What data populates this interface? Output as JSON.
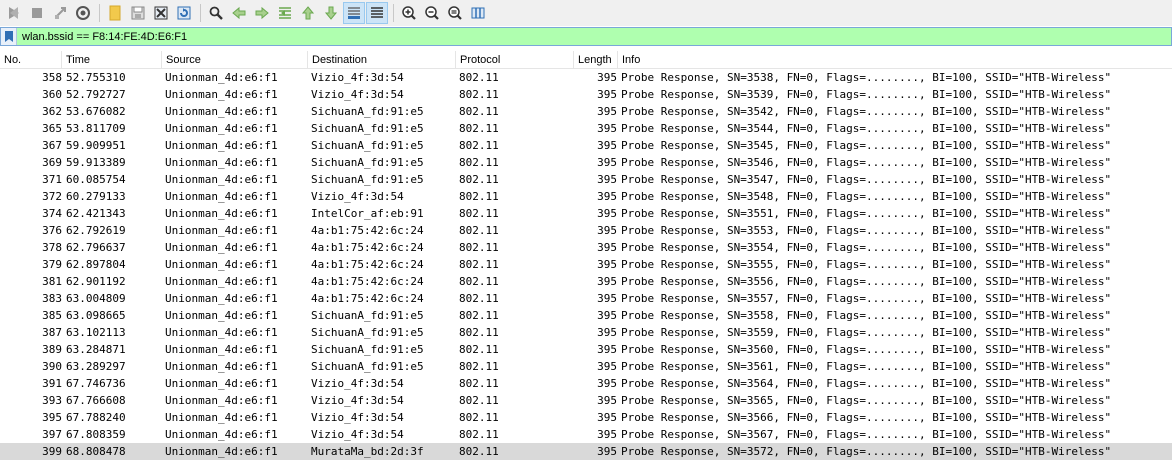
{
  "toolbar": {
    "buttons": [
      {
        "name": "start-capture-icon",
        "color": "#9a9a9a"
      },
      {
        "name": "stop-capture-icon",
        "color": "#9a9a9a"
      },
      {
        "name": "restart-capture-icon",
        "color": "#9a9a9a"
      },
      {
        "name": "capture-options-gear-icon",
        "color": "#555555"
      },
      {
        "name": "open-file-icon",
        "color": "#f2c94c"
      },
      {
        "name": "save-file-icon",
        "color": "#9a9a9a"
      },
      {
        "name": "close-file-icon",
        "color": "#333333"
      },
      {
        "name": "reload-file-icon",
        "color": "#2f6fb5"
      },
      {
        "name": "find-packet-icon",
        "color": "#333333"
      },
      {
        "name": "go-back-icon",
        "color": "#6aa84f"
      },
      {
        "name": "go-forward-icon",
        "color": "#6aa84f"
      },
      {
        "name": "go-to-packet-icon",
        "color": "#6aa84f"
      },
      {
        "name": "go-first-packet-icon",
        "color": "#6aa84f"
      },
      {
        "name": "go-last-packet-icon",
        "color": "#6aa84f"
      },
      {
        "name": "autoscroll-icon",
        "color": "#2f6fb5"
      },
      {
        "name": "colorize-icon",
        "color": "#333333"
      },
      {
        "name": "zoom-in-icon",
        "color": "#333333"
      },
      {
        "name": "zoom-out-icon",
        "color": "#333333"
      },
      {
        "name": "zoom-normal-icon",
        "color": "#333333"
      },
      {
        "name": "resize-columns-icon",
        "color": "#2f6fb5"
      }
    ]
  },
  "filter": {
    "value": "wlan.bssid == F8:14:FE:4D:E6:F1",
    "background": "#afffaf"
  },
  "columns": [
    "No.",
    "Time",
    "Source",
    "Destination",
    "Protocol",
    "Length",
    "Info"
  ],
  "rows": [
    {
      "no": "358",
      "time": "52.755310",
      "src": "Unionman_4d:e6:f1",
      "dst": "Vizio_4f:3d:54",
      "proto": "802.11",
      "len": "395",
      "info": "Probe Response, SN=3538, FN=0, Flags=........, BI=100, SSID=\"HTB-Wireless\""
    },
    {
      "no": "360",
      "time": "52.792727",
      "src": "Unionman_4d:e6:f1",
      "dst": "Vizio_4f:3d:54",
      "proto": "802.11",
      "len": "395",
      "info": "Probe Response, SN=3539, FN=0, Flags=........, BI=100, SSID=\"HTB-Wireless\""
    },
    {
      "no": "362",
      "time": "53.676082",
      "src": "Unionman_4d:e6:f1",
      "dst": "SichuanA_fd:91:e5",
      "proto": "802.11",
      "len": "395",
      "info": "Probe Response, SN=3542, FN=0, Flags=........, BI=100, SSID=\"HTB-Wireless\""
    },
    {
      "no": "365",
      "time": "53.811709",
      "src": "Unionman_4d:e6:f1",
      "dst": "SichuanA_fd:91:e5",
      "proto": "802.11",
      "len": "395",
      "info": "Probe Response, SN=3544, FN=0, Flags=........, BI=100, SSID=\"HTB-Wireless\""
    },
    {
      "no": "367",
      "time": "59.909951",
      "src": "Unionman_4d:e6:f1",
      "dst": "SichuanA_fd:91:e5",
      "proto": "802.11",
      "len": "395",
      "info": "Probe Response, SN=3545, FN=0, Flags=........, BI=100, SSID=\"HTB-Wireless\""
    },
    {
      "no": "369",
      "time": "59.913389",
      "src": "Unionman_4d:e6:f1",
      "dst": "SichuanA_fd:91:e5",
      "proto": "802.11",
      "len": "395",
      "info": "Probe Response, SN=3546, FN=0, Flags=........, BI=100, SSID=\"HTB-Wireless\""
    },
    {
      "no": "371",
      "time": "60.085754",
      "src": "Unionman_4d:e6:f1",
      "dst": "SichuanA_fd:91:e5",
      "proto": "802.11",
      "len": "395",
      "info": "Probe Response, SN=3547, FN=0, Flags=........, BI=100, SSID=\"HTB-Wireless\""
    },
    {
      "no": "372",
      "time": "60.279133",
      "src": "Unionman_4d:e6:f1",
      "dst": "Vizio_4f:3d:54",
      "proto": "802.11",
      "len": "395",
      "info": "Probe Response, SN=3548, FN=0, Flags=........, BI=100, SSID=\"HTB-Wireless\""
    },
    {
      "no": "374",
      "time": "62.421343",
      "src": "Unionman_4d:e6:f1",
      "dst": "IntelCor_af:eb:91",
      "proto": "802.11",
      "len": "395",
      "info": "Probe Response, SN=3551, FN=0, Flags=........, BI=100, SSID=\"HTB-Wireless\""
    },
    {
      "no": "376",
      "time": "62.792619",
      "src": "Unionman_4d:e6:f1",
      "dst": "4a:b1:75:42:6c:24",
      "proto": "802.11",
      "len": "395",
      "info": "Probe Response, SN=3553, FN=0, Flags=........, BI=100, SSID=\"HTB-Wireless\""
    },
    {
      "no": "378",
      "time": "62.796637",
      "src": "Unionman_4d:e6:f1",
      "dst": "4a:b1:75:42:6c:24",
      "proto": "802.11",
      "len": "395",
      "info": "Probe Response, SN=3554, FN=0, Flags=........, BI=100, SSID=\"HTB-Wireless\""
    },
    {
      "no": "379",
      "time": "62.897804",
      "src": "Unionman_4d:e6:f1",
      "dst": "4a:b1:75:42:6c:24",
      "proto": "802.11",
      "len": "395",
      "info": "Probe Response, SN=3555, FN=0, Flags=........, BI=100, SSID=\"HTB-Wireless\""
    },
    {
      "no": "381",
      "time": "62.901192",
      "src": "Unionman_4d:e6:f1",
      "dst": "4a:b1:75:42:6c:24",
      "proto": "802.11",
      "len": "395",
      "info": "Probe Response, SN=3556, FN=0, Flags=........, BI=100, SSID=\"HTB-Wireless\""
    },
    {
      "no": "383",
      "time": "63.004809",
      "src": "Unionman_4d:e6:f1",
      "dst": "4a:b1:75:42:6c:24",
      "proto": "802.11",
      "len": "395",
      "info": "Probe Response, SN=3557, FN=0, Flags=........, BI=100, SSID=\"HTB-Wireless\""
    },
    {
      "no": "385",
      "time": "63.098665",
      "src": "Unionman_4d:e6:f1",
      "dst": "SichuanA_fd:91:e5",
      "proto": "802.11",
      "len": "395",
      "info": "Probe Response, SN=3558, FN=0, Flags=........, BI=100, SSID=\"HTB-Wireless\""
    },
    {
      "no": "387",
      "time": "63.102113",
      "src": "Unionman_4d:e6:f1",
      "dst": "SichuanA_fd:91:e5",
      "proto": "802.11",
      "len": "395",
      "info": "Probe Response, SN=3559, FN=0, Flags=........, BI=100, SSID=\"HTB-Wireless\""
    },
    {
      "no": "389",
      "time": "63.284871",
      "src": "Unionman_4d:e6:f1",
      "dst": "SichuanA_fd:91:e5",
      "proto": "802.11",
      "len": "395",
      "info": "Probe Response, SN=3560, FN=0, Flags=........, BI=100, SSID=\"HTB-Wireless\""
    },
    {
      "no": "390",
      "time": "63.289297",
      "src": "Unionman_4d:e6:f1",
      "dst": "SichuanA_fd:91:e5",
      "proto": "802.11",
      "len": "395",
      "info": "Probe Response, SN=3561, FN=0, Flags=........, BI=100, SSID=\"HTB-Wireless\""
    },
    {
      "no": "391",
      "time": "67.746736",
      "src": "Unionman_4d:e6:f1",
      "dst": "Vizio_4f:3d:54",
      "proto": "802.11",
      "len": "395",
      "info": "Probe Response, SN=3564, FN=0, Flags=........, BI=100, SSID=\"HTB-Wireless\""
    },
    {
      "no": "393",
      "time": "67.766608",
      "src": "Unionman_4d:e6:f1",
      "dst": "Vizio_4f:3d:54",
      "proto": "802.11",
      "len": "395",
      "info": "Probe Response, SN=3565, FN=0, Flags=........, BI=100, SSID=\"HTB-Wireless\""
    },
    {
      "no": "395",
      "time": "67.788240",
      "src": "Unionman_4d:e6:f1",
      "dst": "Vizio_4f:3d:54",
      "proto": "802.11",
      "len": "395",
      "info": "Probe Response, SN=3566, FN=0, Flags=........, BI=100, SSID=\"HTB-Wireless\""
    },
    {
      "no": "397",
      "time": "67.808359",
      "src": "Unionman_4d:e6:f1",
      "dst": "Vizio_4f:3d:54",
      "proto": "802.11",
      "len": "395",
      "info": "Probe Response, SN=3567, FN=0, Flags=........, BI=100, SSID=\"HTB-Wireless\""
    },
    {
      "no": "399",
      "time": "68.808478",
      "src": "Unionman_4d:e6:f1",
      "dst": "MurataMa_bd:2d:3f",
      "proto": "802.11",
      "len": "395",
      "info": "Probe Response, SN=3572, FN=0, Flags=........, BI=100, SSID=\"HTB-Wireless\"",
      "selected": true
    }
  ]
}
